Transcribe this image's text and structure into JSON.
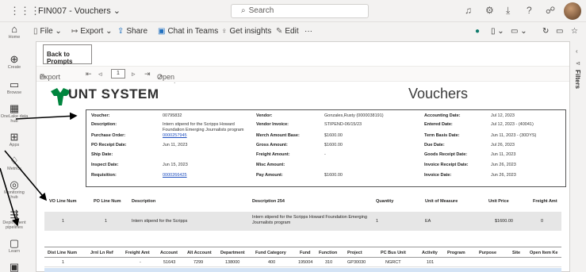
{
  "topbar": {
    "app_title": "FIN007 - Vouchers",
    "title_chevron": "⌄",
    "search_placeholder": "Search"
  },
  "rail": [
    {
      "label": "Home",
      "icon": "⌂"
    },
    {
      "label": "Create",
      "icon": "⊕"
    },
    {
      "label": "Browse",
      "icon": "▭"
    },
    {
      "label": "OneLake data hub",
      "icon": "▦"
    },
    {
      "label": "Apps",
      "icon": "⊞"
    },
    {
      "label": "Metrics",
      "icon": "♢"
    },
    {
      "label": "Monitoring hub",
      "icon": "◎"
    },
    {
      "label": "Deployment pipelines",
      "icon": "⇶"
    },
    {
      "label": "Learn",
      "icon": "▢"
    },
    {
      "label": "",
      "icon": "▣"
    }
  ],
  "cmdbar": {
    "file": "File",
    "export": "Export",
    "share": "Share",
    "chat": "Chat in Teams",
    "insights": "Get insights",
    "edit": "Edit",
    "more": "···"
  },
  "canvas": {
    "back_button": "Back to Prompts",
    "toolbar": {
      "export": "Export",
      "page": "1",
      "open_report": "Open report"
    },
    "filters_label": "Filters"
  },
  "report": {
    "logo_text": "UNT SYSTEM",
    "title": "Vouchers",
    "header": {
      "voucher_label": "Voucher:",
      "voucher": "00795832",
      "description_label": "Description:",
      "description": "Intern stipend for the Scripps Howard Foundation Emerging Journalists program",
      "po_label": "Purchase Order:",
      "po": "0000257945",
      "po_receipt_label": "PO Receipt Date:",
      "po_receipt": "Jun 11, 2023",
      "ship_label": "Ship Date:",
      "ship": "",
      "inspect_label": "Inspect Date:",
      "inspect": "Jun 15, 2023",
      "req_label": "Requisition:",
      "req": "0000266425",
      "vendor_label": "Vendor:",
      "vendor": "Gonzales,Rusty (0000038191)",
      "vendor_inv_label": "Vendor Invoice:",
      "vendor_inv": "STIPEND-06/15/23",
      "merch_label": "Merch Amount Base:",
      "merch": "$1600.00",
      "gross_label": "Gross Amount:",
      "gross": "$1600.00",
      "freight_label": "Freight Amount:",
      "freight": "-",
      "misc_label": "Misc Amount:",
      "misc": "",
      "pay_label": "Pay Amount:",
      "pay": "$1600.00",
      "acct_date_label": "Accounting Date:",
      "acct_date": "Jul 12, 2023",
      "entered_label": "Entered Date:",
      "entered": "Jul 12, 2023 - (40041)",
      "term_label": "Term Basis Date:",
      "term": "Jun 11, 2023 - (30DYS)",
      "due_label": "Due Date:",
      "due": "Jul 26, 2023",
      "goods_label": "Goods Receipt Date:",
      "goods": "Jun 11, 2023",
      "inv_receipt_label": "Invoice Receipt Date:",
      "inv_receipt": "Jun 26, 2023",
      "inv_date_label": "Invoice Date:",
      "inv_date": "Jun 26, 2023"
    },
    "lines": {
      "headers": [
        "VO Line Num",
        "PO Line Num",
        "Description",
        "Description 254",
        "Quantity",
        "Unit of Measure",
        "Unit Price",
        "Freight Amt"
      ],
      "row": [
        "1",
        "1",
        "Intern stipend for the Scripps",
        "Intern stipend for the Scripps Howard Foundation Emerging Journalists program",
        "1",
        "EA",
        "$1600.00",
        "0"
      ]
    },
    "distribution": {
      "headers": [
        "Dist Line Num",
        "Jrnl Ln Ref",
        "Freight Amt",
        "Account",
        "Alt Account",
        "Department",
        "Fund Category",
        "Fund",
        "Function",
        "Project",
        "PC Bus Unit",
        "Activity",
        "Program",
        "Purpose",
        "Site",
        "Open Item Ke"
      ],
      "row": [
        "1",
        "",
        "-",
        "51643",
        "7299",
        "138000",
        "400",
        "195004",
        "310",
        "GP30030",
        "NGRCT",
        "101",
        "",
        "",
        "",
        ""
      ]
    }
  }
}
